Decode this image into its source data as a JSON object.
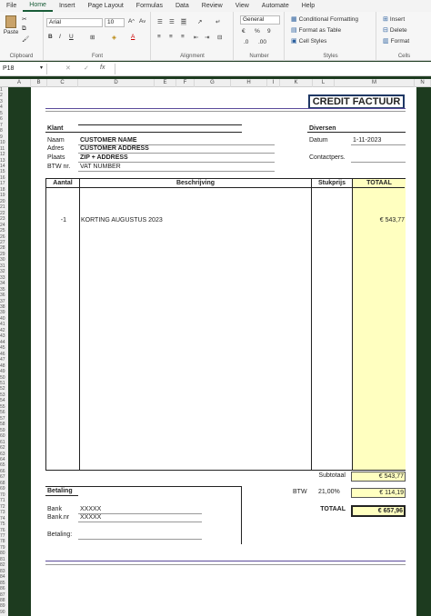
{
  "menu": {
    "tabs": [
      "File",
      "Home",
      "Insert",
      "Page Layout",
      "Formulas",
      "Data",
      "Review",
      "View",
      "Automate",
      "Help"
    ]
  },
  "ribbon": {
    "clipboard": {
      "paste": "Paste",
      "label": "Clipboard"
    },
    "font": {
      "name": "Arial",
      "size": "10",
      "bold": "B",
      "italic": "I",
      "underline": "U",
      "label": "Font"
    },
    "alignment": {
      "label": "Alignment"
    },
    "number": {
      "format": "General",
      "currency": "€",
      "percent": "%",
      "comma": "9",
      "label": "Number"
    },
    "styles": {
      "conditional": "Conditional Formatting",
      "format_table": "Format as Table",
      "cell_styles": "Cell Styles",
      "label": "Styles"
    },
    "cells": {
      "insert": "Insert",
      "delete": "Delete",
      "format": "Format",
      "label": "Cells"
    }
  },
  "formula_bar": {
    "name_box": "P18",
    "value": ""
  },
  "columns": [
    "A",
    "B",
    "C",
    "D",
    "E",
    "F",
    "G",
    "H",
    "I",
    "K",
    "L",
    "M",
    "N"
  ],
  "invoice": {
    "title": "CREDIT FACTUUR",
    "klant": {
      "heading": "Klant",
      "naam_label": "Naam",
      "naam": "CUSTOMER NAME",
      "adres_label": "Adres",
      "adres": "CUSTOMER ADDRESS",
      "plaats_label": "Plaats",
      "plaats": "ZIP + ADDRESS",
      "btw_label": "BTW nr.",
      "btw": "VAT NUMBER"
    },
    "diversen": {
      "heading": "Diversen",
      "datum_label": "Datum",
      "datum": "1-11-2023",
      "contact_label": "Contactpers."
    },
    "table": {
      "headers": [
        "Aantal",
        "Beschrijving",
        "Stukprijs",
        "TOTAAL"
      ],
      "rows": [
        {
          "aantal": "-1",
          "beschrijving": "KORTING AUGUSTUS 2023",
          "totaal": "€ 543,77"
        }
      ]
    },
    "totals": {
      "subtotaal_label": "Subtotaal",
      "subtotaal": "€ 543,77",
      "btw_label": "BTW",
      "btw_pct": "21,00%",
      "btw": "€ 114,19",
      "totaal_label": "TOTAAL",
      "totaal": "€ 657,96"
    },
    "betaling": {
      "heading": "Betaling",
      "bank_label": "Bank",
      "bank": "XXXXX",
      "banknr_label": "Bank.nr",
      "banknr": "XXXXX",
      "betaling_label": "Betaling:"
    }
  },
  "colors": {
    "accent": "#185c37",
    "highlight": "#ffffc0",
    "title_border": "#1f3864",
    "band": "#5a4a9a"
  }
}
